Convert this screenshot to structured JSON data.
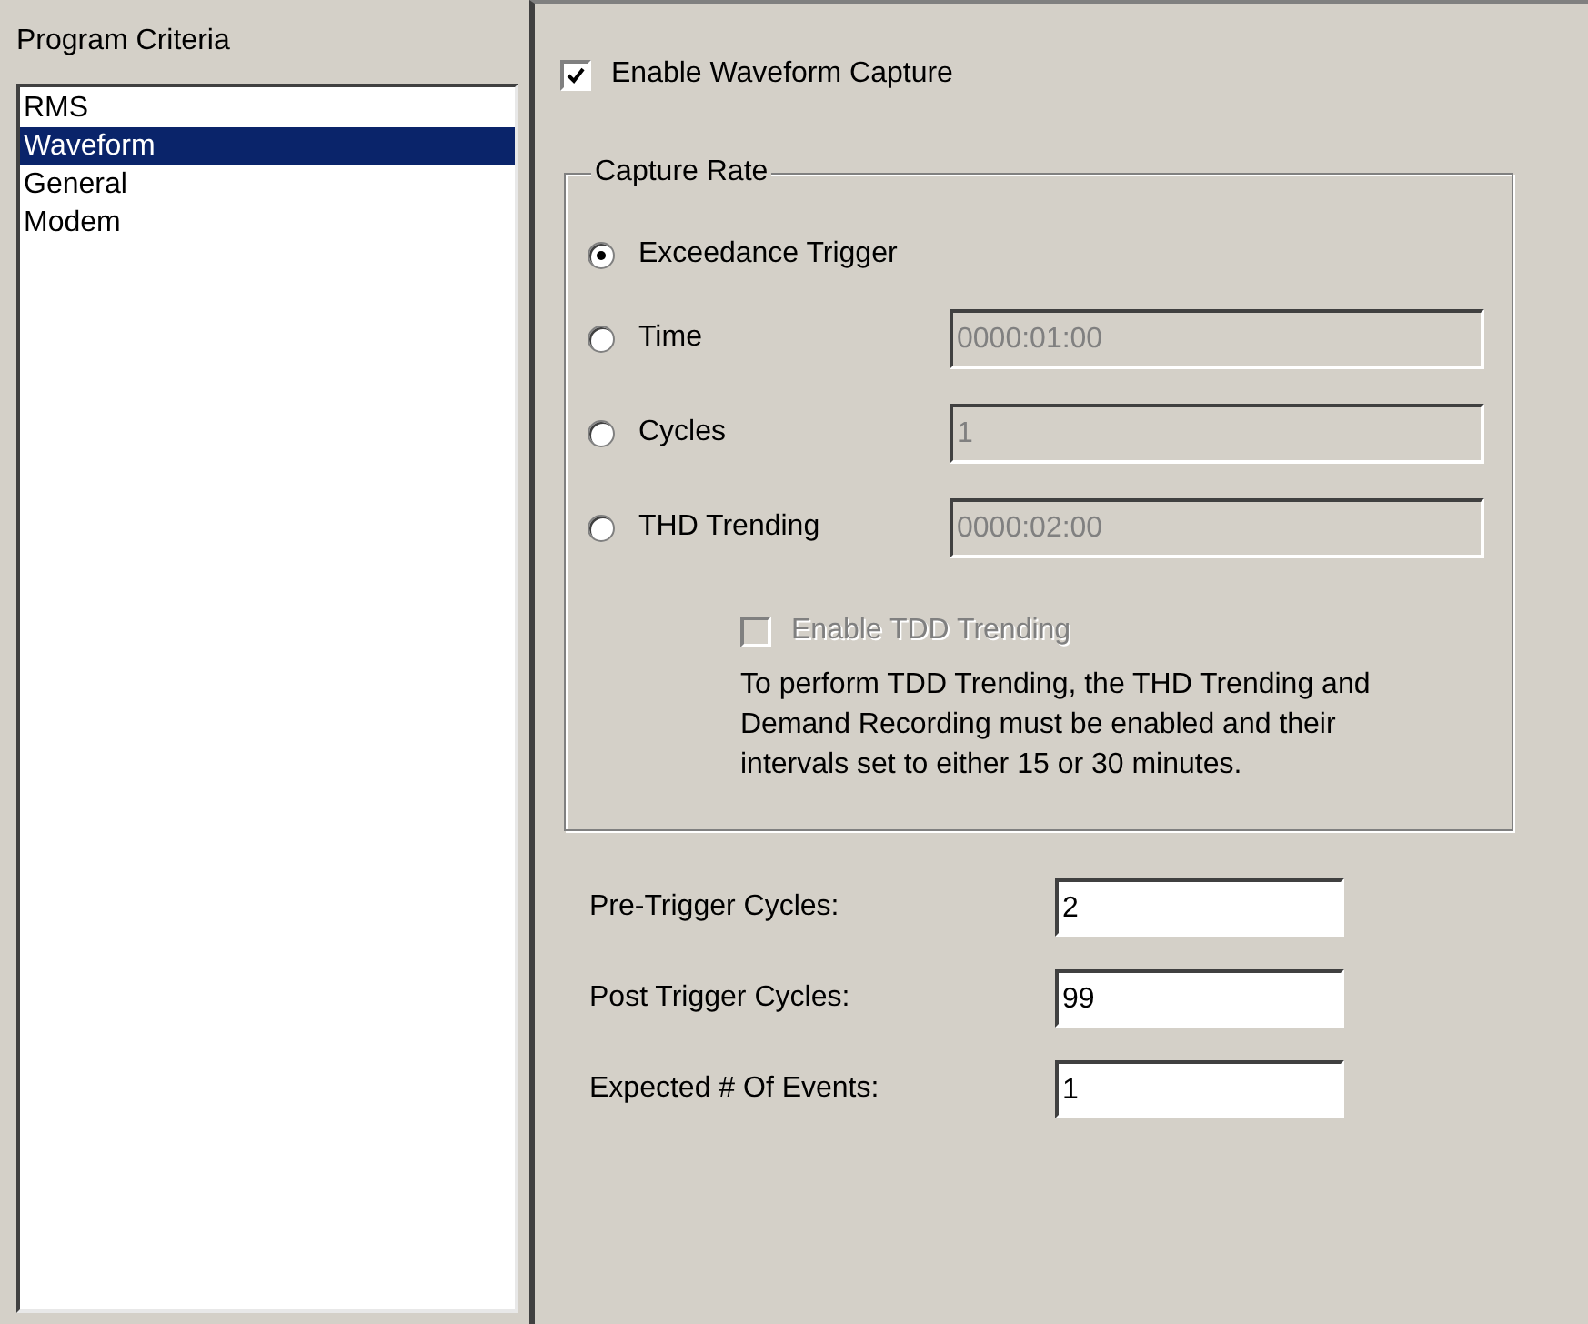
{
  "sidebar": {
    "title": "Program  Criteria",
    "items": [
      {
        "label": "RMS",
        "selected": false
      },
      {
        "label": "Waveform",
        "selected": true
      },
      {
        "label": "General",
        "selected": false
      },
      {
        "label": "Modem",
        "selected": false
      }
    ]
  },
  "enable_capture": {
    "label": "Enable Waveform Capture",
    "checked": true
  },
  "capture_rate": {
    "title": "Capture Rate",
    "options": [
      {
        "label": "Exceedance Trigger",
        "selected": true
      },
      {
        "label": "Time",
        "selected": false,
        "value": "0000:01:00",
        "disabled": true
      },
      {
        "label": "Cycles",
        "selected": false,
        "value": "1",
        "disabled": true
      },
      {
        "label": "THD Trending",
        "selected": false,
        "value": "0000:02:00",
        "disabled": true
      }
    ],
    "tdd": {
      "label": "Enable TDD Trending",
      "checked": false,
      "disabled": true
    },
    "note": "To perform TDD Trending, the THD Trending and Demand Recording must be enabled and their intervals set to either 15 or 30 minutes."
  },
  "fields": [
    {
      "label": "Pre-Trigger Cycles:",
      "value": "2"
    },
    {
      "label": "Post Trigger Cycles:",
      "value": "99"
    },
    {
      "label": "Expected # Of Events:",
      "value": "1"
    }
  ]
}
